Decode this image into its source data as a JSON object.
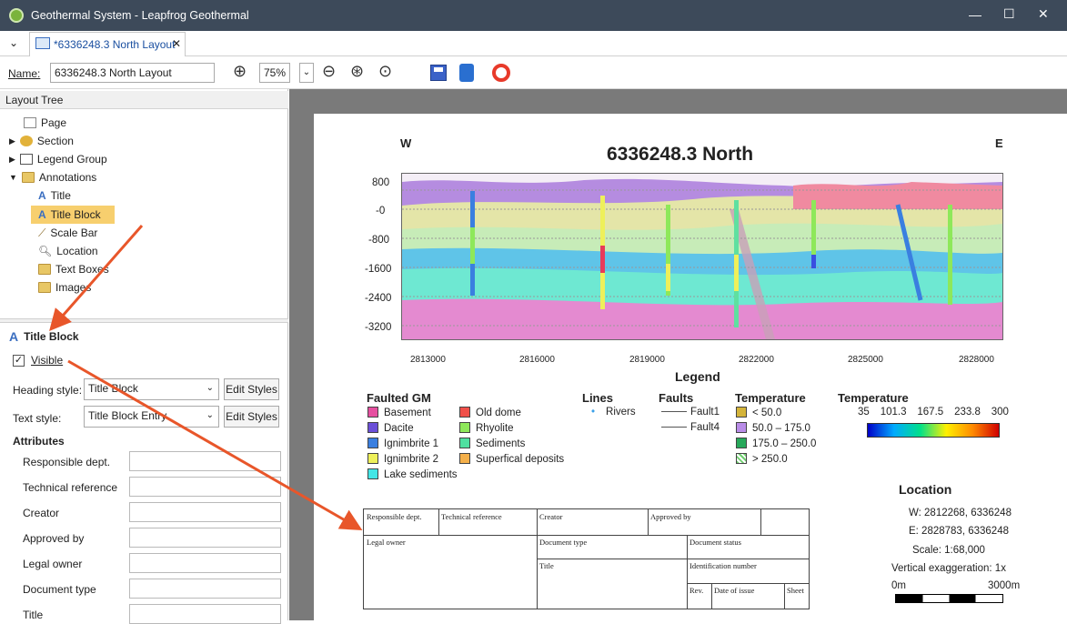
{
  "window": {
    "title": "Geothermal System - Leapfrog Geothermal"
  },
  "tab": {
    "label": "*6336248.3 North Layout"
  },
  "toolbar": {
    "name_label": "Name:",
    "name_value": "6336248.3 North Layout",
    "zoom": "75%"
  },
  "layout_tree": {
    "header": "Layout Tree",
    "items": [
      {
        "label": "Page"
      },
      {
        "label": "Section"
      },
      {
        "label": "Legend Group"
      },
      {
        "label": "Annotations"
      },
      {
        "label": "Title"
      },
      {
        "label": "Title Block"
      },
      {
        "label": "Scale Bar"
      },
      {
        "label": "Location"
      },
      {
        "label": "Text Boxes"
      },
      {
        "label": "Images"
      }
    ]
  },
  "props": {
    "title": "Title Block",
    "visible_label": "Visible",
    "heading_style_label": "Heading style:",
    "heading_style_value": "Title Block",
    "text_style_label": "Text style:",
    "text_style_value": "Title Block Entry",
    "edit_styles": "Edit Styles",
    "attributes_header": "Attributes",
    "attributes": [
      {
        "label": "Responsible dept."
      },
      {
        "label": "Technical reference"
      },
      {
        "label": "Creator"
      },
      {
        "label": "Approved by"
      },
      {
        "label": "Legal owner"
      },
      {
        "label": "Document type"
      },
      {
        "label": "Title"
      }
    ]
  },
  "section": {
    "title": "6336248.3 North",
    "west": "W",
    "east": "E",
    "y_ticks": [
      "800",
      "-0",
      "-800",
      "-1600",
      "-2400",
      "-3200"
    ],
    "x_ticks": [
      "2813000",
      "2816000",
      "2819000",
      "2822000",
      "2825000",
      "2828000"
    ]
  },
  "legend": {
    "title": "Legend",
    "faulted_gm_title": "Faulted GM",
    "units": [
      {
        "label": "Basement",
        "color": "#e64fa0"
      },
      {
        "label": "Dacite",
        "color": "#6b4fd8"
      },
      {
        "label": "Ignimbrite 1",
        "color": "#3a7fe0"
      },
      {
        "label": "Ignimbrite 2",
        "color": "#eef05a"
      },
      {
        "label": "Lake sediments",
        "color": "#43e6e6"
      },
      {
        "label": "Old dome",
        "color": "#f0504a"
      },
      {
        "label": "Rhyolite",
        "color": "#8ee85a"
      },
      {
        "label": "Sediments",
        "color": "#4fe0a0"
      },
      {
        "label": "Superfical deposits",
        "color": "#f5b04a"
      }
    ],
    "lines_title": "Lines",
    "lines": [
      {
        "label": "Rivers"
      }
    ],
    "faults_title": "Faults",
    "faults": [
      {
        "label": "Fault1"
      },
      {
        "label": "Fault4"
      }
    ],
    "temperature_title": "Temperature",
    "temp_classes": [
      {
        "label": "< 50.0",
        "color": "#d4b43a"
      },
      {
        "label": "50.0 – 175.0",
        "color": "#b98ce8"
      },
      {
        "label": "175.0 – 250.0",
        "color": "#27a85a"
      },
      {
        "label": "> 250.0",
        "color": "#6fcf6f"
      }
    ],
    "temp_scale_title": "Temperature",
    "temp_scale_ticks": [
      "35",
      "101.3",
      "167.5",
      "233.8",
      "300"
    ]
  },
  "title_block": {
    "responsible": "Responsible dept.",
    "technical": "Technical reference",
    "creator": "Creator",
    "approved": "Approved by",
    "legal_owner": "Legal owner",
    "document_type": "Document type",
    "document_status": "Document status",
    "title": "Title",
    "identification": "Identification number",
    "rev": "Rev.",
    "date_issue": "Date of issue",
    "sheet": "Sheet"
  },
  "location": {
    "title": "Location",
    "w": "W:  2812268, 6336248",
    "e": "E:   2828783, 6336248",
    "scale": "Scale: 1:68,000",
    "vexag": "Vertical exaggeration: 1x",
    "bar_start": "0m",
    "bar_end": "3000m"
  }
}
